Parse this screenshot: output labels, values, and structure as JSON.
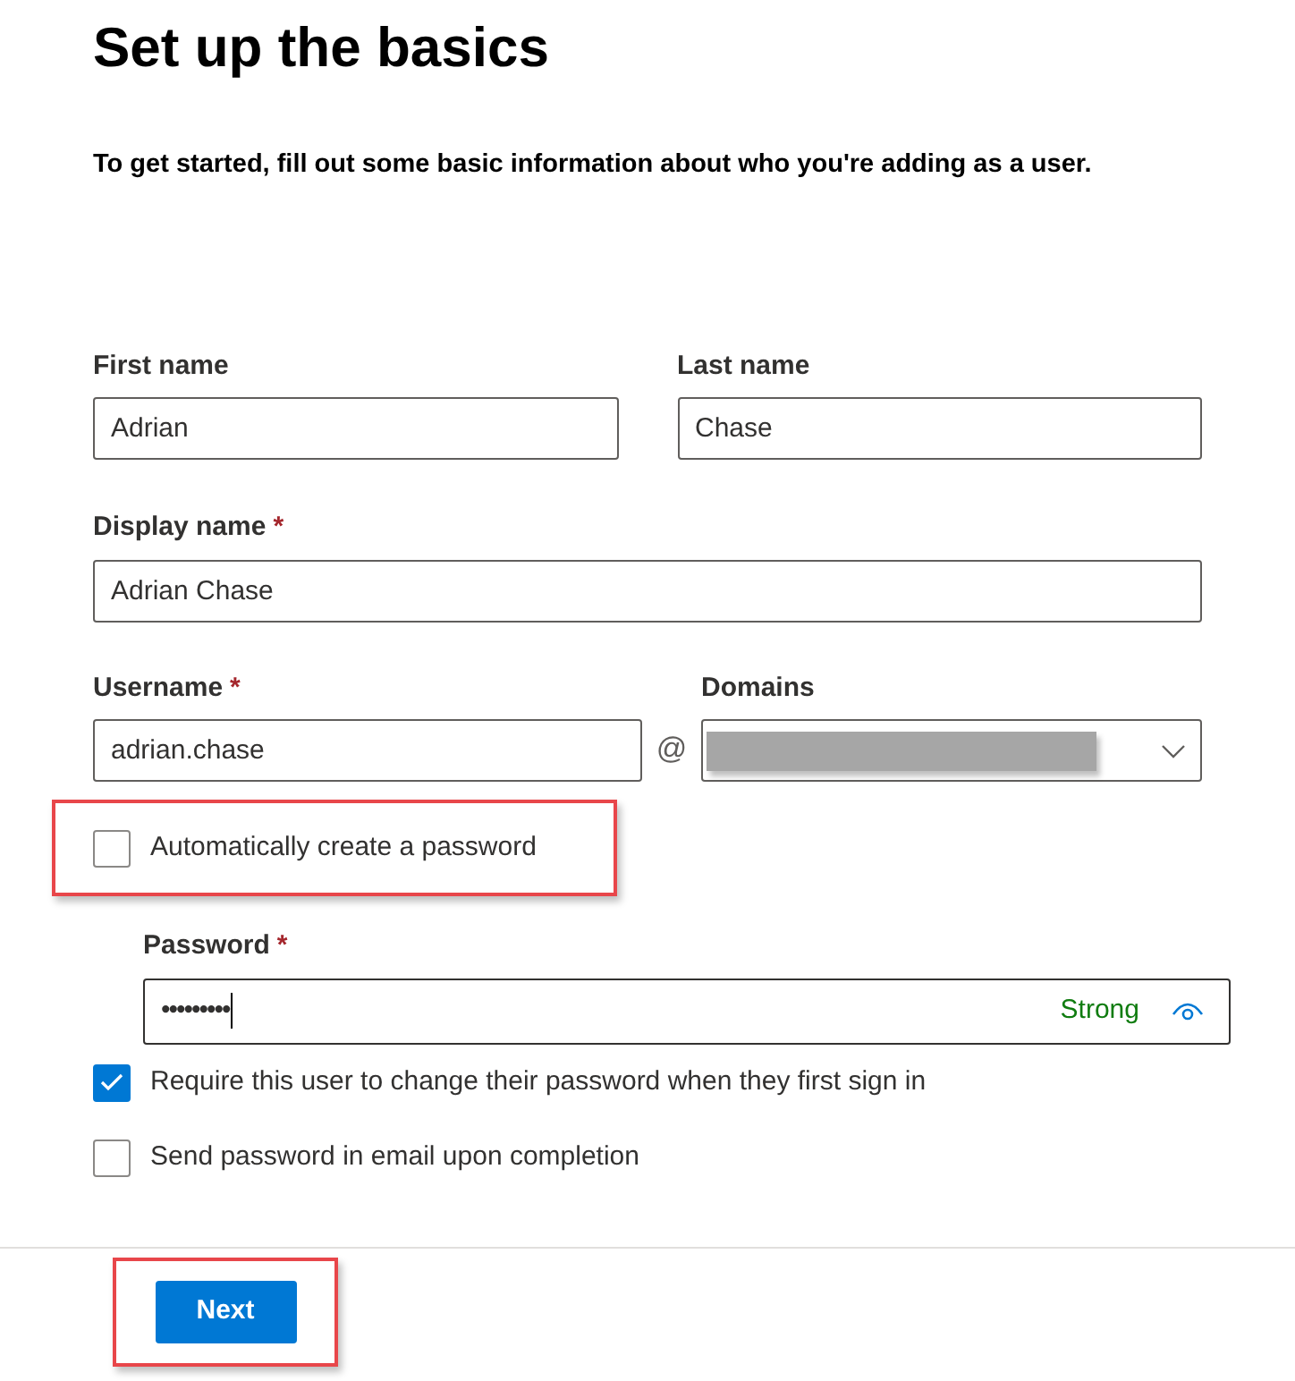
{
  "title": "Set up the basics",
  "intro": "To get started, fill out some basic information about who you're adding as a user.",
  "name_row": [
    {
      "label": "First name",
      "value": "Adrian"
    },
    {
      "label": "Last name",
      "value": "Chase"
    }
  ],
  "display_name": {
    "label": "Display name",
    "required_mark": "*",
    "value": "Adrian Chase"
  },
  "username": {
    "label": "Username",
    "required_mark": "*",
    "value": "adrian.chase"
  },
  "at_sign": "@",
  "domains": {
    "label": "Domains"
  },
  "auto_password": {
    "label": "Automatically create a password",
    "checked": false,
    "highlighted": true
  },
  "password": {
    "label": "Password",
    "required_mark": "*",
    "value": "•••••••••",
    "strength": "Strong"
  },
  "options": [
    {
      "label": "Require this user to change their password when they first sign in",
      "checked": true
    },
    {
      "label": "Send password in email upon completion",
      "checked": false
    }
  ],
  "next_button": {
    "label": "Next",
    "highlighted": true
  }
}
